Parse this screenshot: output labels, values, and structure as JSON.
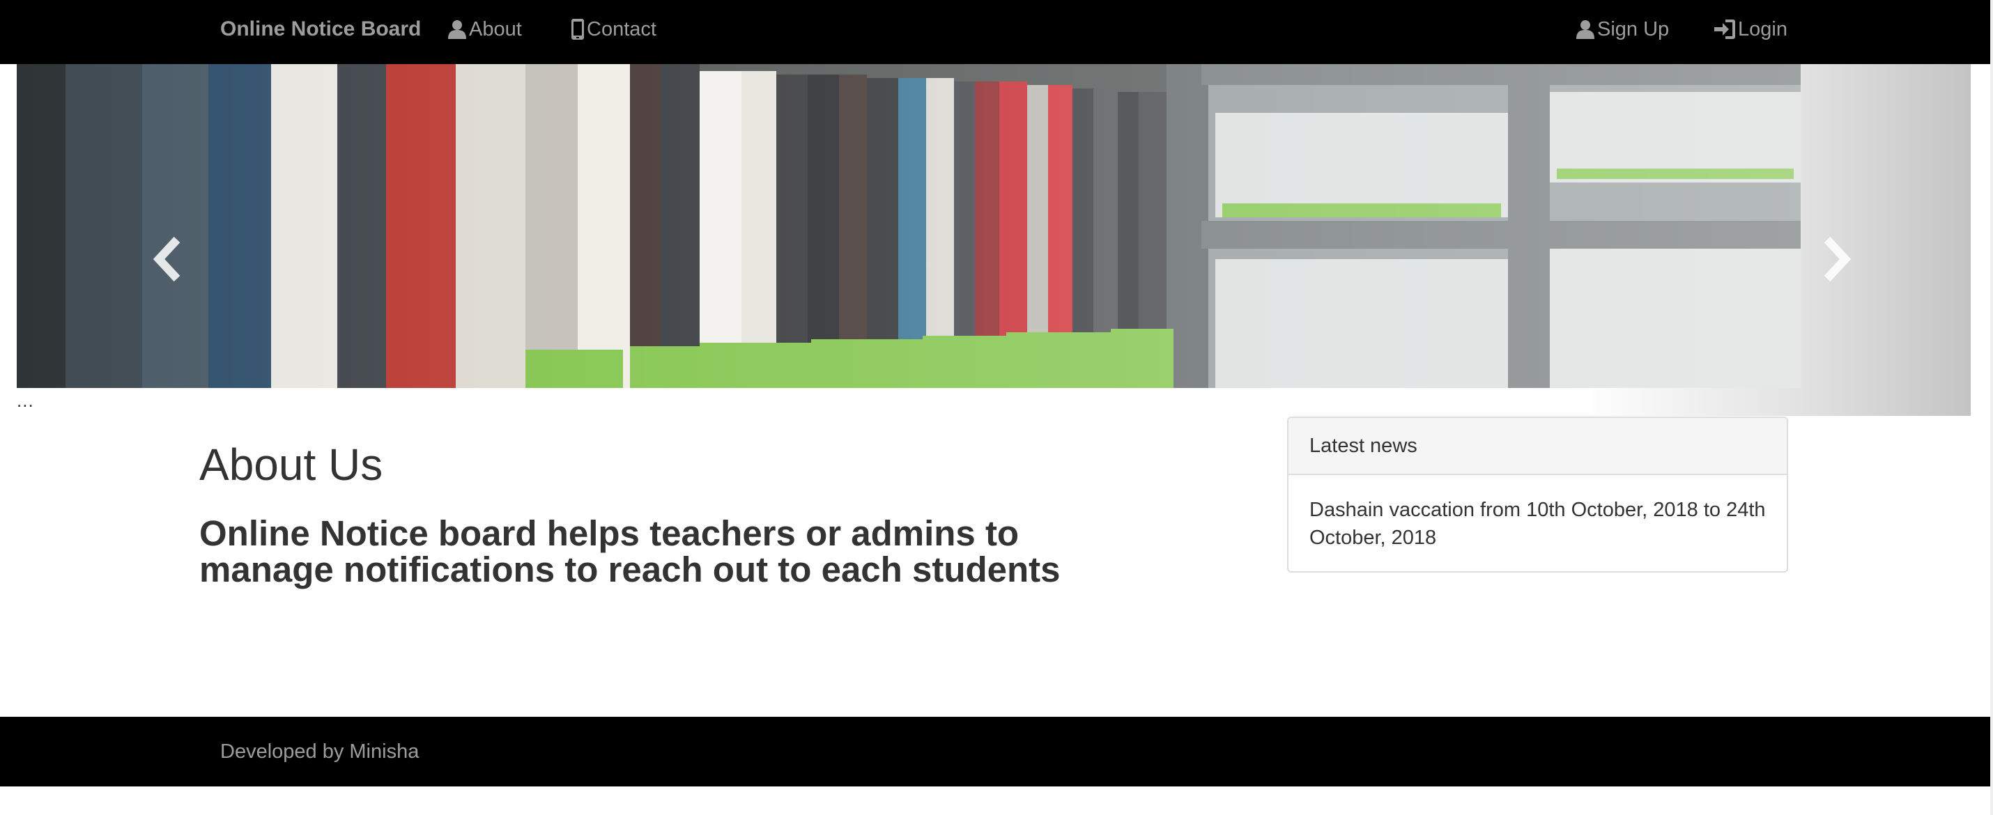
{
  "navbar": {
    "brand": "Online Notice Board",
    "about": "About",
    "contact": "Contact",
    "signup": "Sign Up",
    "login": "Login"
  },
  "carousel": {
    "caption": "...",
    "slide_count": 3,
    "active_index": 2
  },
  "main": {
    "title": "About Us",
    "description": "Online Notice board helps teachers or admins to manage notifications to reach out to each students"
  },
  "news_panel": {
    "heading": "Latest news",
    "item": "Dashain vaccation from 10th October, 2018 to 24th October, 2018"
  },
  "footer": {
    "text": "Developed by Minisha"
  },
  "colors": {
    "navbar_bg": "#000000",
    "nav_text": "#9d9d9d",
    "panel_heading_bg": "#f5f5f5",
    "book_accent_green": "#7cc243"
  }
}
